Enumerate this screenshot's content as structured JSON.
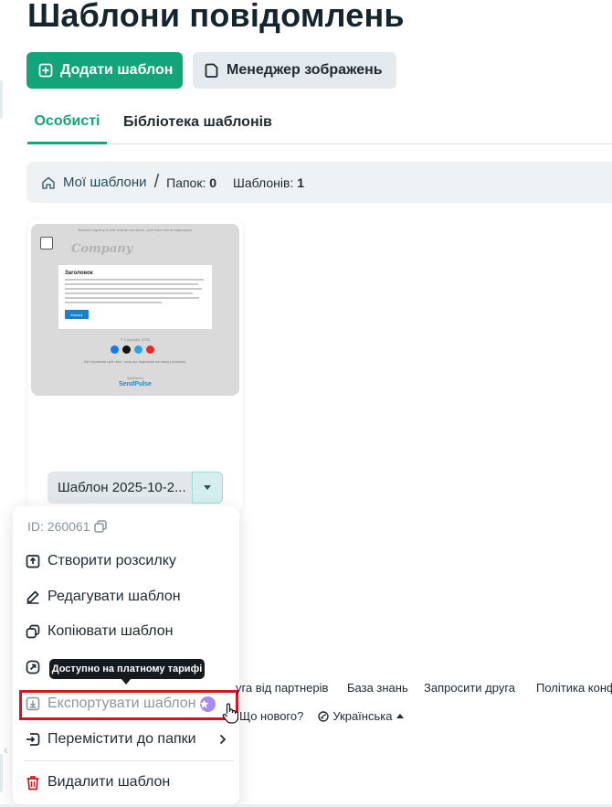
{
  "page": {
    "title": "Шаблони повідомлень"
  },
  "toolbar": {
    "add_label": "Додати шаблон",
    "image_manager_label": "Менеджер зображень"
  },
  "tabs": [
    {
      "label": "Особисті",
      "active": true
    },
    {
      "label": "Бібліотека шаблонів",
      "active": false
    }
  ],
  "breadcrumb": {
    "home_label": "Мої шаблони",
    "folders_label": "Папок:",
    "folders_count": "0",
    "templates_label": "Шаблонів:",
    "templates_count": "1"
  },
  "template_card": {
    "name": "Шаблон 2025-10-2...",
    "preview": {
      "top_note": "Візьміть адресу в свій список контактів, щоб наші листи надходили",
      "logo": "Company",
      "heading": "Заголовок",
      "button": "Кнопка",
      "copyright": "© Copyright, 2025",
      "unsubscribe": "Ви отримали цей лист, тому що підписані на нашу розсилку.",
      "made_with": "Зроблено з",
      "brand": "SendPulse"
    }
  },
  "context_menu": {
    "id_label": "ID: 260061",
    "items": [
      {
        "label": "Створити розсилку",
        "icon": "send-icon"
      },
      {
        "label": "Редагувати шаблон",
        "icon": "pencil-icon"
      },
      {
        "label": "Копіювати шаблон",
        "icon": "copy-icon"
      },
      {
        "label": "",
        "icon": "link-icon"
      },
      {
        "label": "Експортувати шаблон",
        "icon": "export-icon",
        "disabled": true
      },
      {
        "label": "Перемістити до папки",
        "icon": "move-icon"
      },
      {
        "label": "Видалити шаблон",
        "icon": "trash-icon"
      }
    ]
  },
  "tooltip": {
    "text": "Доступно на платному тарифі"
  },
  "footer": {
    "links": [
      "уга від партнерів",
      "База знань",
      "Запросити друга",
      "Політика конф"
    ],
    "whats_new": "Що нового?",
    "language": "Українська"
  },
  "colors": {
    "primary": "#13a479",
    "danger": "#d6141c",
    "premium": "#a98cf3"
  }
}
